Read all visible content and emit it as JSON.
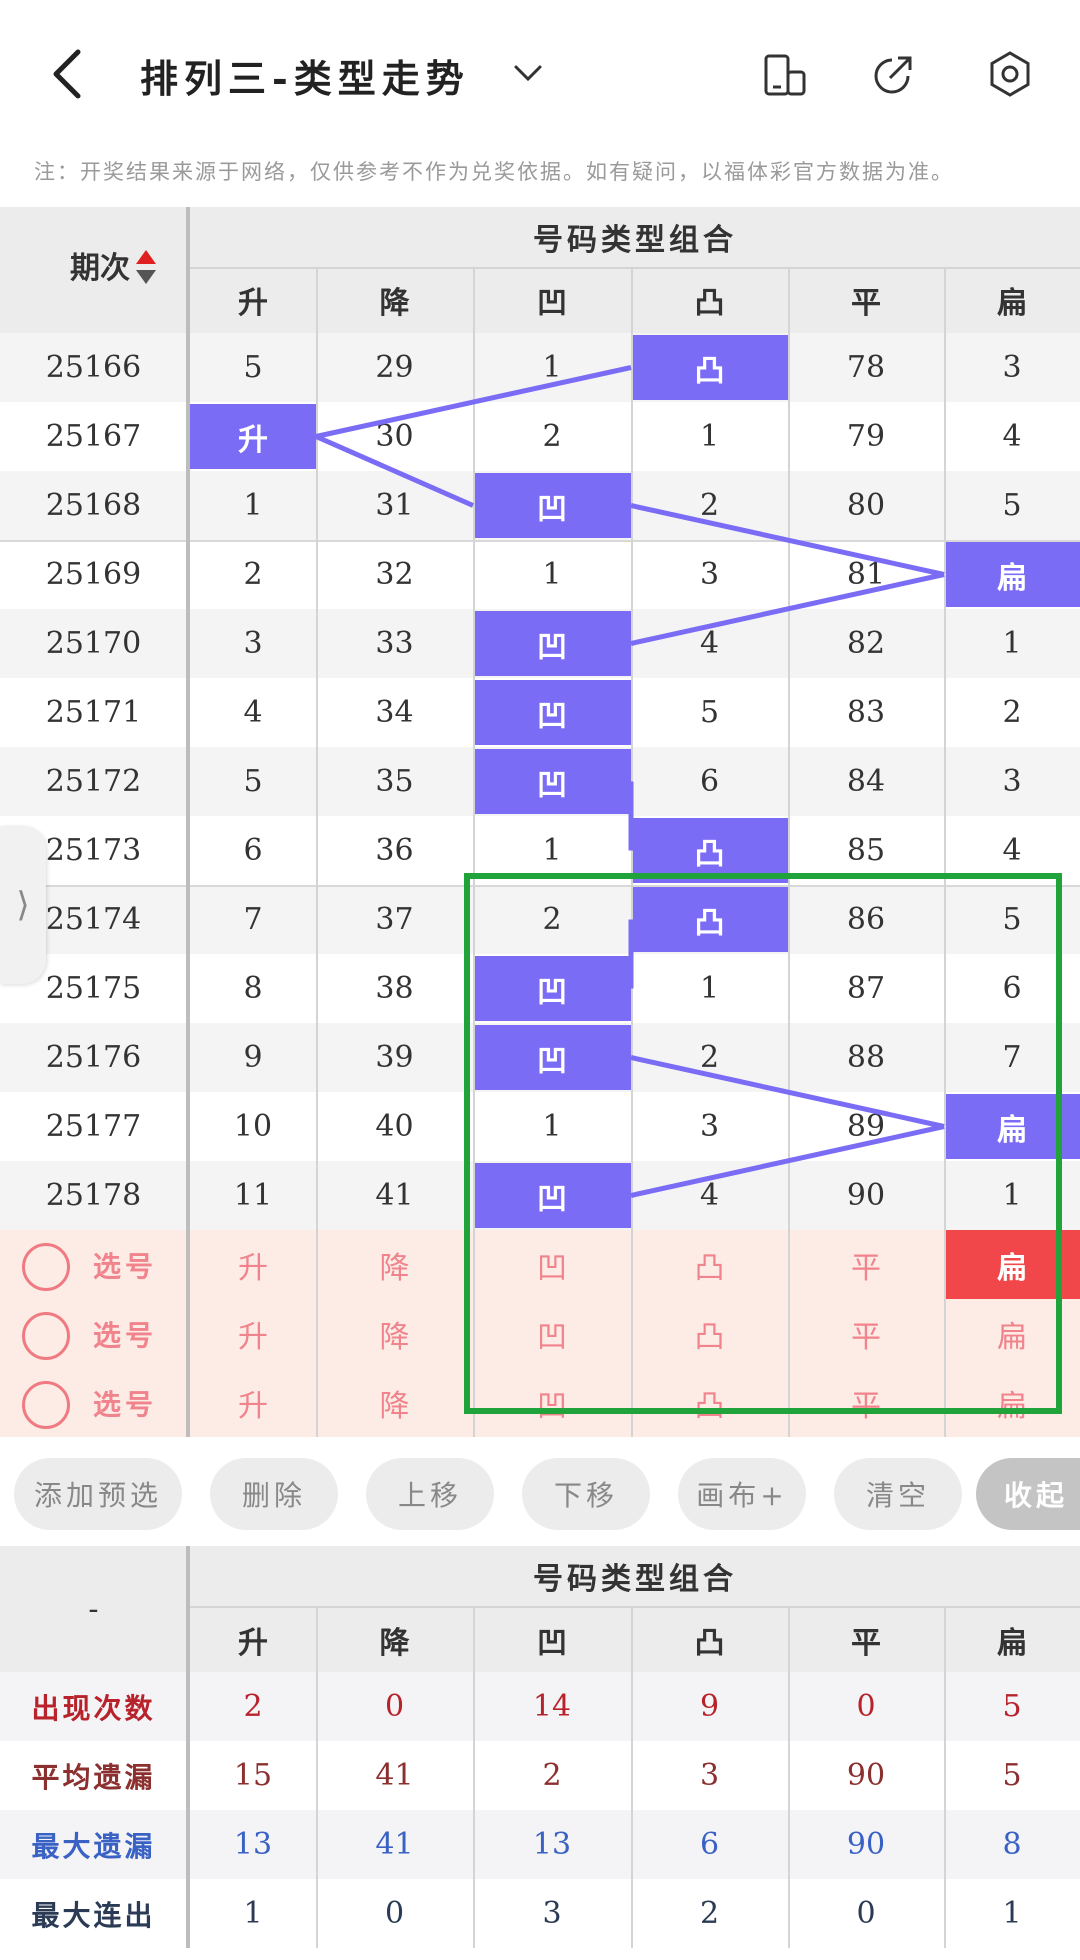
{
  "header": {
    "title": "排列三-类型走势",
    "back_icon": "chevron-left-icon",
    "dropdown_icon": "chevron-down-icon",
    "icons": [
      "phone-landscape-icon",
      "share-icon",
      "settings-icon"
    ]
  },
  "note": "注：开奖结果来源于网络，仅供参考不作为兑奖依据。如有疑问，以福体彩官方数据为准。",
  "trend_table": {
    "period_label": "期次",
    "group_label": "号码类型组合",
    "columns": [
      "升",
      "降",
      "凹",
      "凸",
      "平",
      "扁"
    ],
    "rows": [
      {
        "period": "25166",
        "cells": [
          "5",
          "29",
          "1",
          "凸",
          "78",
          "3"
        ],
        "hit": 3
      },
      {
        "period": "25167",
        "cells": [
          "升",
          "30",
          "2",
          "1",
          "79",
          "4"
        ],
        "hit": 0
      },
      {
        "period": "25168",
        "cells": [
          "1",
          "31",
          "凹",
          "2",
          "80",
          "5"
        ],
        "hit": 2
      },
      {
        "period": "25169",
        "cells": [
          "2",
          "32",
          "1",
          "3",
          "81",
          "扁"
        ],
        "hit": 5
      },
      {
        "period": "25170",
        "cells": [
          "3",
          "33",
          "凹",
          "4",
          "82",
          "1"
        ],
        "hit": 2
      },
      {
        "period": "25171",
        "cells": [
          "4",
          "34",
          "凹",
          "5",
          "83",
          "2"
        ],
        "hit": 2
      },
      {
        "period": "25172",
        "cells": [
          "5",
          "35",
          "凹",
          "6",
          "84",
          "3"
        ],
        "hit": 2
      },
      {
        "period": "25173",
        "cells": [
          "6",
          "36",
          "1",
          "凸",
          "85",
          "4"
        ],
        "hit": 3
      },
      {
        "period": "25174",
        "cells": [
          "7",
          "37",
          "2",
          "凸",
          "86",
          "5"
        ],
        "hit": 3
      },
      {
        "period": "25175",
        "cells": [
          "8",
          "38",
          "凹",
          "1",
          "87",
          "6"
        ],
        "hit": 2
      },
      {
        "period": "25176",
        "cells": [
          "9",
          "39",
          "凹",
          "2",
          "88",
          "7"
        ],
        "hit": 2
      },
      {
        "period": "25177",
        "cells": [
          "10",
          "40",
          "1",
          "3",
          "89",
          "扁"
        ],
        "hit": 5
      },
      {
        "period": "25178",
        "cells": [
          "11",
          "41",
          "凹",
          "4",
          "90",
          "1"
        ],
        "hit": 2
      }
    ],
    "pick_rows": [
      {
        "label": "选号",
        "cells": [
          "升",
          "降",
          "凹",
          "凸",
          "平",
          "扁"
        ],
        "selected": 5
      },
      {
        "label": "选号",
        "cells": [
          "升",
          "降",
          "凹",
          "凸",
          "平",
          "扁"
        ],
        "selected": -1
      },
      {
        "label": "选号",
        "cells": [
          "升",
          "降",
          "凹",
          "凸",
          "平",
          "扁"
        ],
        "selected": -1
      }
    ]
  },
  "toolbar": {
    "buttons": [
      "添加预选",
      "删除",
      "上移",
      "下移",
      "画布+",
      "清空",
      "收起"
    ]
  },
  "stats_table": {
    "corner_label": "-",
    "group_label": "号码类型组合",
    "columns": [
      "升",
      "降",
      "凹",
      "凸",
      "平",
      "扁"
    ],
    "rows": [
      {
        "label": "出现次数",
        "values": [
          "2",
          "0",
          "14",
          "9",
          "0",
          "5"
        ],
        "color": "#b8232b"
      },
      {
        "label": "平均遗漏",
        "values": [
          "15",
          "41",
          "2",
          "3",
          "90",
          "5"
        ],
        "color": "#8b2f2f"
      },
      {
        "label": "最大遗漏",
        "values": [
          "13",
          "41",
          "13",
          "6",
          "90",
          "8"
        ],
        "color": "#3a62c4"
      },
      {
        "label": "最大连出",
        "values": [
          "1",
          "0",
          "3",
          "2",
          "0",
          "1"
        ],
        "color": "#2b3a55"
      }
    ]
  },
  "colors": {
    "hit": "#7b6cf6",
    "pick_selected": "#f2474a",
    "annotation_box": "#1fa33a"
  }
}
